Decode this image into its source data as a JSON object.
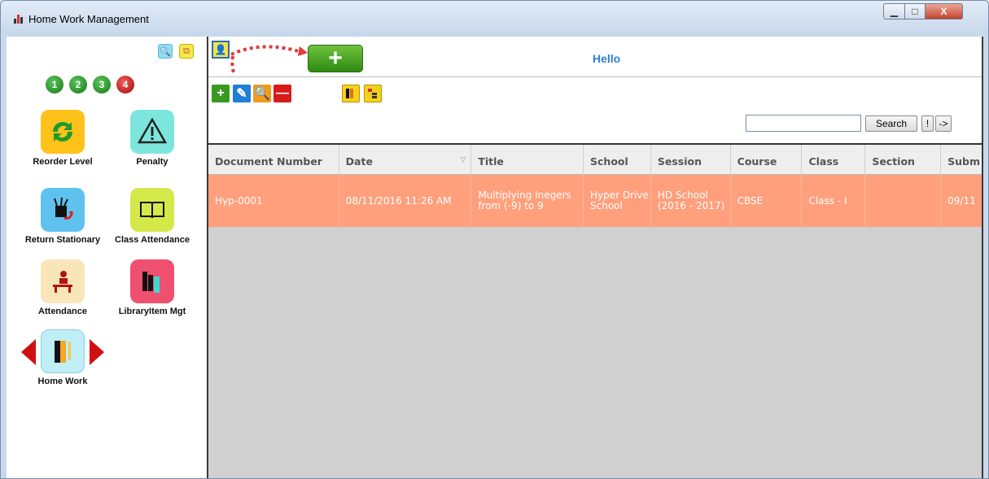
{
  "window": {
    "title": "Home Work Management",
    "controls": {
      "minimize": "▁",
      "maximize": "□",
      "close": "X"
    }
  },
  "left": {
    "steps": [
      "1",
      "2",
      "3",
      "4"
    ],
    "tiles": [
      {
        "label": "Reorder Level"
      },
      {
        "label": "Penalty"
      },
      {
        "label": "Return Stationary"
      },
      {
        "label": "Class Attendance"
      },
      {
        "label": "Attendance"
      },
      {
        "label": "LibraryItem Mgt"
      },
      {
        "label": "Home Work"
      }
    ]
  },
  "header": {
    "greeting": "Hello"
  },
  "search": {
    "value": "",
    "button": "Search",
    "excl": "!",
    "next": "->"
  },
  "grid": {
    "columns": [
      "Document Number",
      "Date",
      "Title",
      "School",
      "Session",
      "Course",
      "Class",
      "Section",
      "Subm"
    ],
    "rows": [
      [
        "Hyp-0001",
        "08/11/2016 11:26 AM",
        "Multiplying Inegers from (-9) to 9",
        "Hyper Drive School",
        "HD School (2016 - 2017)",
        "CBSE",
        "Class - I",
        "",
        "09/11"
      ]
    ]
  },
  "colors": {
    "accent": "#2a7fd4",
    "row_highlight": "#ff9f7c",
    "active_label": "#e01010"
  }
}
